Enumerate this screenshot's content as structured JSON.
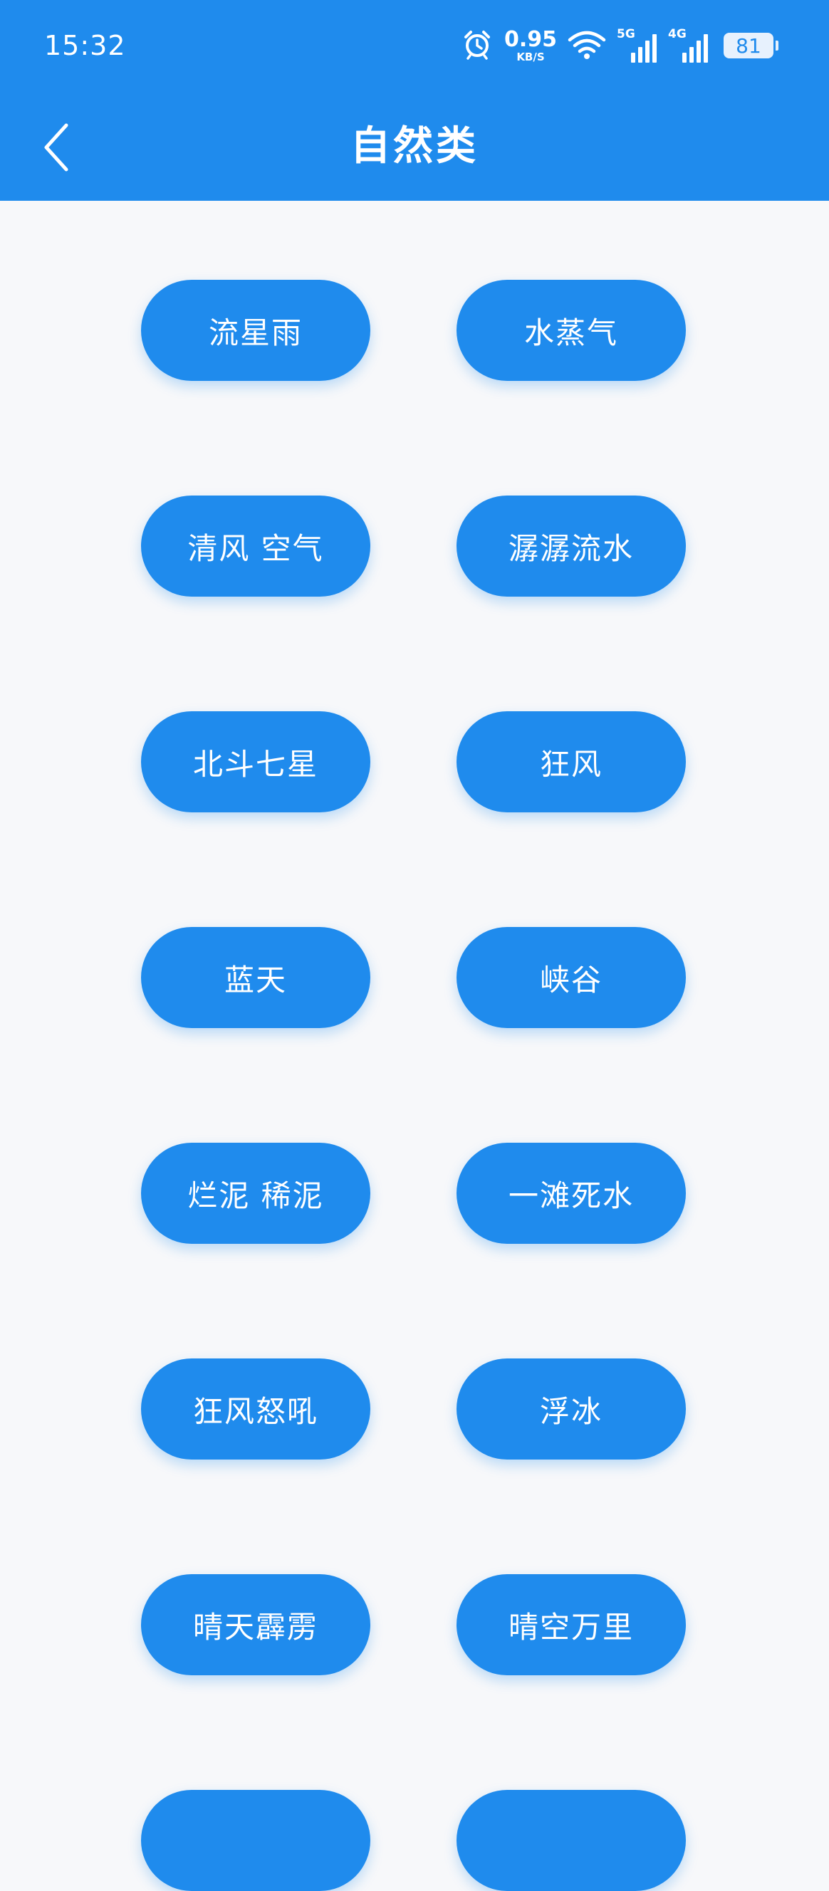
{
  "colors": {
    "accent": "#1f8bed",
    "background": "#f7f8fa"
  },
  "status_bar": {
    "time": "15:32",
    "net_speed_value": "0.95",
    "net_speed_unit": "KB/S",
    "signal_5g_label": "5G",
    "signal_4g_label": "4G",
    "battery_level": "81",
    "icons": [
      "alarm-icon",
      "wifi-icon",
      "signal-bars-icon",
      "battery-icon"
    ]
  },
  "header": {
    "title": "自然类",
    "back_icon": "chevron-left-icon"
  },
  "sound_buttons": [
    {
      "label": "流星雨"
    },
    {
      "label": "水蒸气"
    },
    {
      "label": "清风 空气"
    },
    {
      "label": "潺潺流水"
    },
    {
      "label": "北斗七星"
    },
    {
      "label": "狂风"
    },
    {
      "label": "蓝天"
    },
    {
      "label": "峡谷"
    },
    {
      "label": "烂泥 稀泥"
    },
    {
      "label": "一滩死水"
    },
    {
      "label": "狂风怒吼"
    },
    {
      "label": "浮冰"
    },
    {
      "label": "晴天霹雳"
    },
    {
      "label": "晴空万里"
    },
    {
      "label": ""
    },
    {
      "label": ""
    }
  ]
}
